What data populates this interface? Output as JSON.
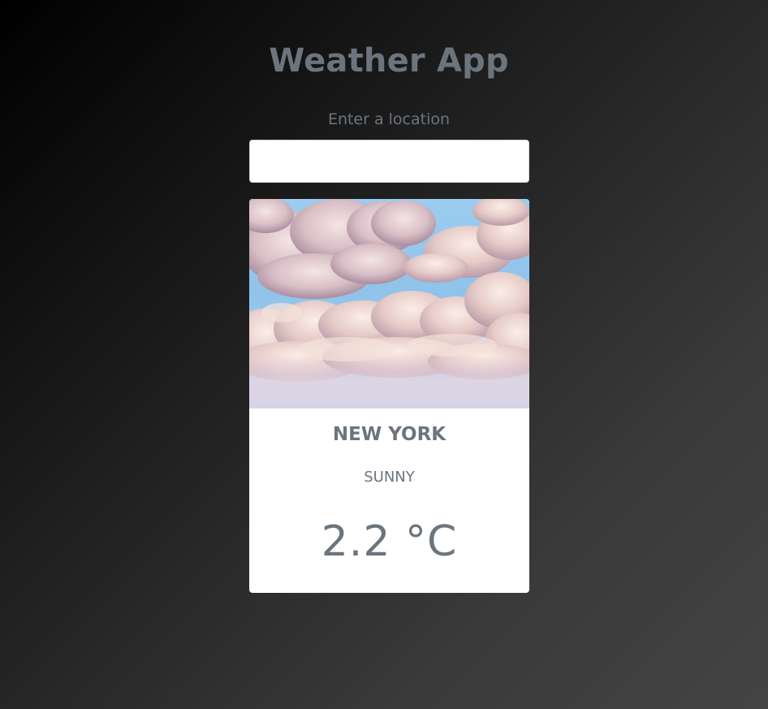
{
  "app": {
    "title": "Weather App"
  },
  "search": {
    "label": "Enter a location",
    "value": "",
    "placeholder": ""
  },
  "weather_card": {
    "image_icon": "sky-clouds-photo",
    "city": "NEW YORK",
    "condition": "SUNNY",
    "temperature": "2.2 °C"
  },
  "colors": {
    "text_muted": "#6c757d",
    "card_background": "#ffffff",
    "sky_blue": "#8fc3ea",
    "cloud_pink": "#e9d3d6"
  }
}
